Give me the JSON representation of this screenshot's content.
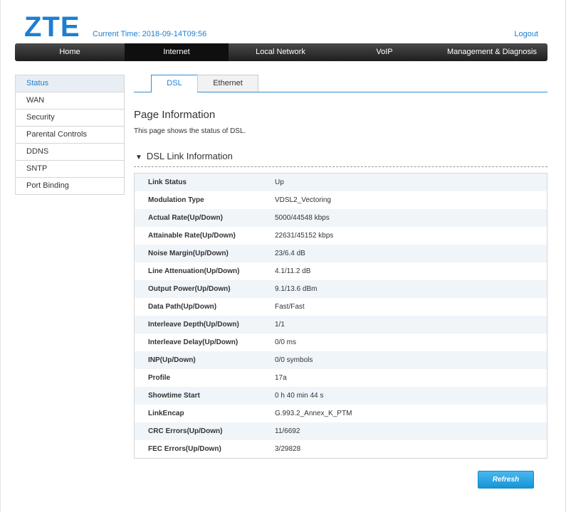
{
  "header": {
    "logo": "ZTE",
    "current_time": "Current Time: 2018-09-14T09:56",
    "logout": "Logout"
  },
  "nav": [
    {
      "label": "Home",
      "active": false
    },
    {
      "label": "Internet",
      "active": true
    },
    {
      "label": "Local Network",
      "active": false
    },
    {
      "label": "VoIP",
      "active": false
    },
    {
      "label": "Management & Diagnosis",
      "active": false
    }
  ],
  "sidebar": [
    {
      "label": "Status",
      "active": true
    },
    {
      "label": "WAN",
      "active": false
    },
    {
      "label": "Security",
      "active": false
    },
    {
      "label": "Parental Controls",
      "active": false
    },
    {
      "label": "DDNS",
      "active": false
    },
    {
      "label": "SNTP",
      "active": false
    },
    {
      "label": "Port Binding",
      "active": false
    }
  ],
  "tabs": [
    {
      "label": "DSL",
      "active": true
    },
    {
      "label": "Ethernet",
      "active": false
    }
  ],
  "page": {
    "title": "Page Information",
    "description": "This page shows the status of DSL."
  },
  "section": {
    "title": "DSL Link Information"
  },
  "dsl_rows": [
    {
      "label": "Link Status",
      "value": "Up"
    },
    {
      "label": "Modulation Type",
      "value": "VDSL2_Vectoring"
    },
    {
      "label": "Actual Rate(Up/Down)",
      "value": "5000/44548 kbps"
    },
    {
      "label": "Attainable Rate(Up/Down)",
      "value": "22631/45152 kbps"
    },
    {
      "label": "Noise Margin(Up/Down)",
      "value": "23/6.4 dB"
    },
    {
      "label": "Line Attenuation(Up/Down)",
      "value": "4.1/11.2 dB"
    },
    {
      "label": "Output Power(Up/Down)",
      "value": "9.1/13.6 dBm"
    },
    {
      "label": "Data Path(Up/Down)",
      "value": "Fast/Fast"
    },
    {
      "label": "Interleave Depth(Up/Down)",
      "value": "1/1"
    },
    {
      "label": "Interleave Delay(Up/Down)",
      "value": "0/0 ms"
    },
    {
      "label": "INP(Up/Down)",
      "value": "0/0 symbols"
    },
    {
      "label": "Profile",
      "value": "17a"
    },
    {
      "label": "Showtime Start",
      "value": "0 h 40 min 44 s"
    },
    {
      "label": "LinkEncap",
      "value": "G.993.2_Annex_K_PTM"
    },
    {
      "label": "CRC Errors(Up/Down)",
      "value": "11/6692"
    },
    {
      "label": "FEC Errors(Up/Down)",
      "value": "3/29828"
    }
  ],
  "actions": {
    "refresh": "Refresh"
  },
  "colors": {
    "brand": "#1d7fd1",
    "nav_bg": "#2a2a2a",
    "nav_active": "#0f0f0f",
    "row_alt": "#f0f5fa",
    "button": "#1795d6"
  }
}
